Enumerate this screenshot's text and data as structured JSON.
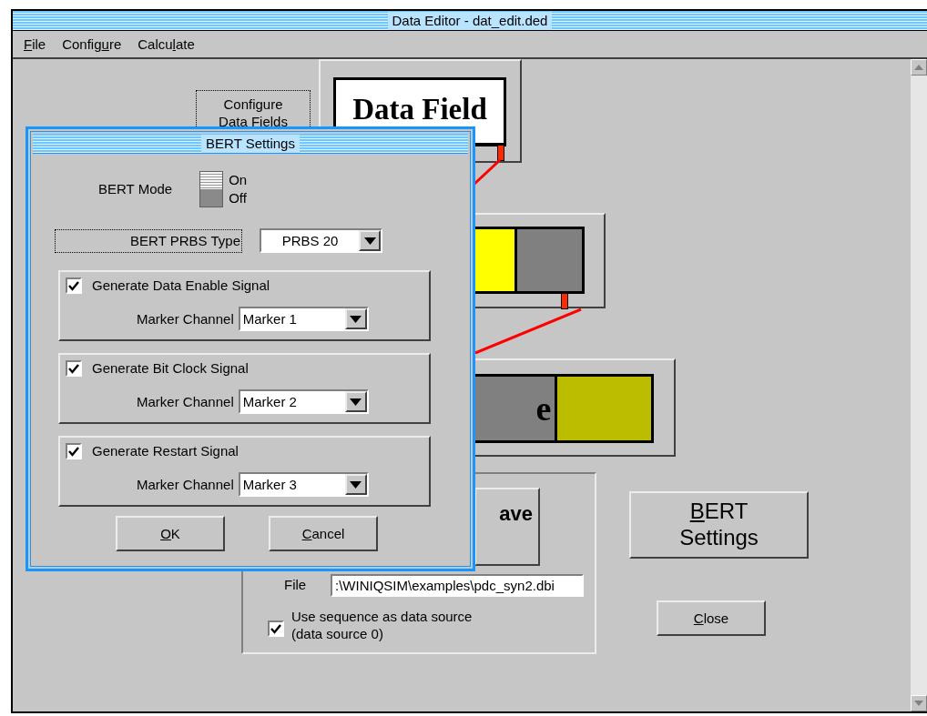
{
  "window": {
    "title": "Data Editor - dat_edit.ded"
  },
  "menu": [
    {
      "label": "File"
    },
    {
      "label": "Configure"
    },
    {
      "label": "Calculate"
    }
  ],
  "canvas": {
    "configure_button": {
      "lines": [
        "Configure",
        "Data Fields"
      ]
    },
    "blocks": [
      {
        "kind": "title",
        "label": "Data Field"
      },
      {
        "kind": "segments",
        "segments": [
          {
            "color": "#ffff00"
          },
          {
            "color": "#808080"
          }
        ]
      },
      {
        "kind": "segments",
        "segments": [
          {
            "color": "#808080",
            "label": "e"
          },
          {
            "color": "#bcbc00"
          }
        ]
      }
    ],
    "save_button": {
      "label": "ave"
    },
    "file": {
      "label": "File",
      "value": ":\\WINIQSIM\\examples\\pdc_syn2.dbi"
    },
    "use_sequence": {
      "checked": true,
      "lines": [
        "Use sequence as data source",
        "(data source 0)"
      ]
    },
    "bert_button": {
      "lines": [
        "BERT",
        "Settings"
      ]
    },
    "close_button": {
      "label": "Close"
    }
  },
  "dialog": {
    "title": "BERT Settings",
    "bert_mode": {
      "label": "BERT Mode",
      "on": true,
      "on_label": "On",
      "off_label": "Off"
    },
    "prbs": {
      "label": "BERT PRBS Type",
      "value": "PRBS 20"
    },
    "signals": [
      {
        "label": "Generate Data Enable Signal",
        "checked": true,
        "channel_label": "Marker Channel",
        "channel": "Marker 1"
      },
      {
        "label": "Generate Bit Clock Signal",
        "checked": true,
        "channel_label": "Marker Channel",
        "channel": "Marker 2"
      },
      {
        "label": "Generate Restart Signal",
        "checked": true,
        "channel_label": "Marker Channel",
        "channel": "Marker 3"
      }
    ],
    "buttons": [
      {
        "label": "OK"
      },
      {
        "label": "Cancel"
      }
    ]
  }
}
